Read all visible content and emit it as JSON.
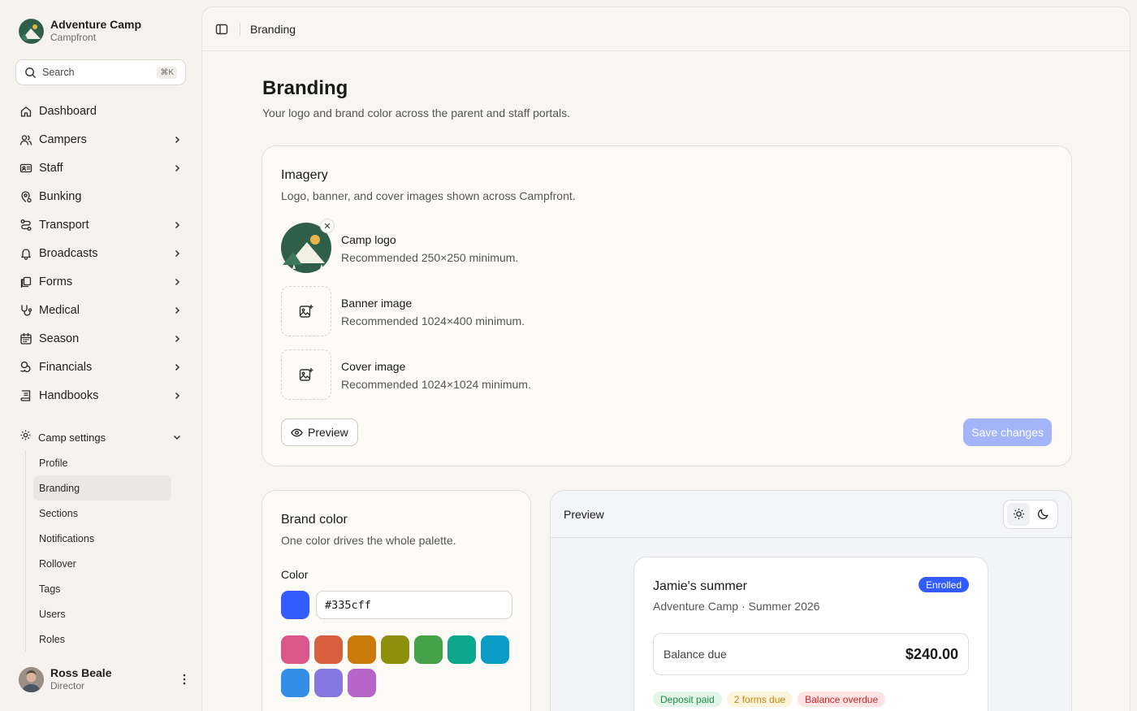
{
  "app": {
    "name": "Adventure Camp",
    "product": "Campfront"
  },
  "search": {
    "label": "Search",
    "shortcut": "⌘K"
  },
  "nav": [
    {
      "label": "Dashboard",
      "icon": "home-icon",
      "chevron": false
    },
    {
      "label": "Campers",
      "icon": "users-icon",
      "chevron": true
    },
    {
      "label": "Staff",
      "icon": "id-card-icon",
      "chevron": true
    },
    {
      "label": "Bunking",
      "icon": "map-pin-icon",
      "chevron": false
    },
    {
      "label": "Transport",
      "icon": "route-icon",
      "chevron": true
    },
    {
      "label": "Broadcasts",
      "icon": "bell-icon",
      "chevron": true
    },
    {
      "label": "Forms",
      "icon": "copy-icon",
      "chevron": true
    },
    {
      "label": "Medical",
      "icon": "stethoscope-icon",
      "chevron": true
    },
    {
      "label": "Season",
      "icon": "calendar-icon",
      "chevron": true
    },
    {
      "label": "Financials",
      "icon": "coins-icon",
      "chevron": true
    },
    {
      "label": "Handbooks",
      "icon": "book-icon",
      "chevron": true
    }
  ],
  "settings": {
    "label": "Camp settings",
    "items": [
      "Profile",
      "Branding",
      "Sections",
      "Notifications",
      "Rollover",
      "Tags",
      "Users",
      "Roles"
    ],
    "active": "Branding"
  },
  "user": {
    "name": "Ross Beale",
    "role": "Director"
  },
  "topbar": {
    "crumb": "Branding"
  },
  "page": {
    "title": "Branding",
    "subtitle": "Your logo and brand color across the parent and staff portals."
  },
  "imagery": {
    "title": "Imagery",
    "subtitle": "Logo, banner, and cover images shown across Campfront.",
    "items": [
      {
        "name": "Camp logo",
        "hint": "Recommended 250×250 minimum."
      },
      {
        "name": "Banner image",
        "hint": "Recommended 1024×400 minimum."
      },
      {
        "name": "Cover image",
        "hint": "Recommended 1024×1024 minimum."
      }
    ],
    "preview_label": "Preview",
    "save_label": "Save changes"
  },
  "brand_color": {
    "title": "Brand color",
    "subtitle": "One color drives the whole palette.",
    "color_label": "Color",
    "value": "#335cff",
    "palette": [
      "#d9578a",
      "#d9603e",
      "#c97a08",
      "#8e8f0c",
      "#43a147",
      "#0ba68b",
      "#0a9ec7",
      "#338ee6",
      "#8676df",
      "#b564c7"
    ]
  },
  "preview": {
    "title": "Preview",
    "card_title": "Jamie's summer",
    "card_sub": "Adventure Camp · Summer 2026",
    "badge": "Enrolled",
    "balance_label": "Balance due",
    "balance_amount": "$240.00",
    "tags": [
      "Deposit paid",
      "2 forms due",
      "Balance overdue"
    ]
  }
}
